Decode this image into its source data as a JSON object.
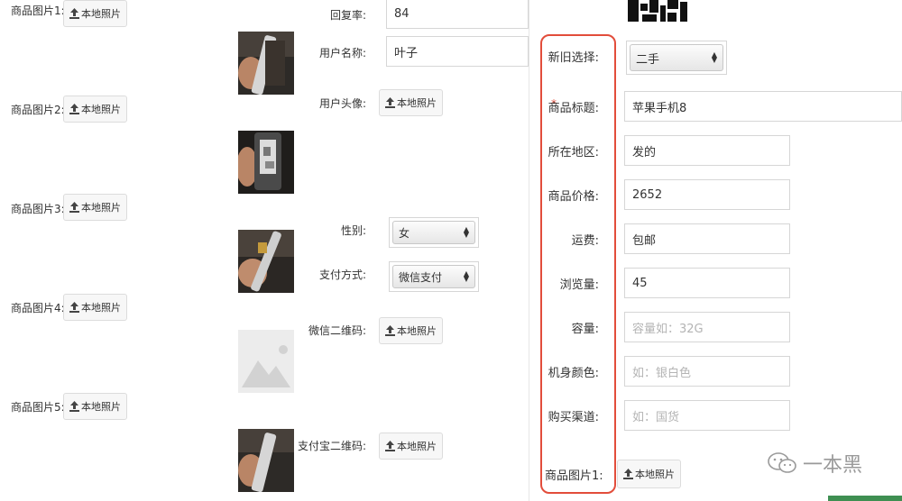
{
  "left_uploads": [
    {
      "label": "商品图片1:",
      "button": "本地照片"
    },
    {
      "label": "商品图片2:",
      "button": "本地照片"
    },
    {
      "label": "商品图片3:",
      "button": "本地照片"
    },
    {
      "label": "商品图片4:",
      "button": "本地照片"
    },
    {
      "label": "商品图片5:",
      "button": "本地照片"
    }
  ],
  "middle": {
    "reply_rate_label": "回复率:",
    "reply_rate_value": "84",
    "username_label": "用户名称:",
    "username_value": "叶子",
    "avatar_label": "用户头像:",
    "avatar_button": "本地照片",
    "gender_label": "性别:",
    "gender_value": "女",
    "payment_label": "支付方式:",
    "payment_value": "微信支付",
    "wechat_qr_label": "微信二维码:",
    "wechat_qr_button": "本地照片",
    "alipay_qr_label": "支付宝二维码:",
    "alipay_qr_button": "本地照片"
  },
  "right_form": {
    "condition_label": "新旧选择:",
    "condition_value": "二手",
    "required_mark": "*",
    "title_label": "商品标题:",
    "title_value": "苹果手机8",
    "location_label": "所在地区:",
    "location_value": "发的",
    "price_label": "商品价格:",
    "price_value": "2652",
    "shipping_label": "运费:",
    "shipping_value": "包邮",
    "views_label": "浏览量:",
    "views_value": "45",
    "capacity_label": "容量:",
    "capacity_placeholder": "容量如：32G",
    "color_label": "机身颜色:",
    "color_placeholder": "如：银白色",
    "channel_label": "购买渠道:",
    "channel_placeholder": "如：国货",
    "image1_label": "商品图片1:",
    "image1_button": "本地照片"
  },
  "watermark": {
    "text": "一本黑"
  },
  "colors": {
    "highlight": "#e24d3b",
    "border": "#d6d6d6",
    "button_bg": "#f7f7f7"
  }
}
